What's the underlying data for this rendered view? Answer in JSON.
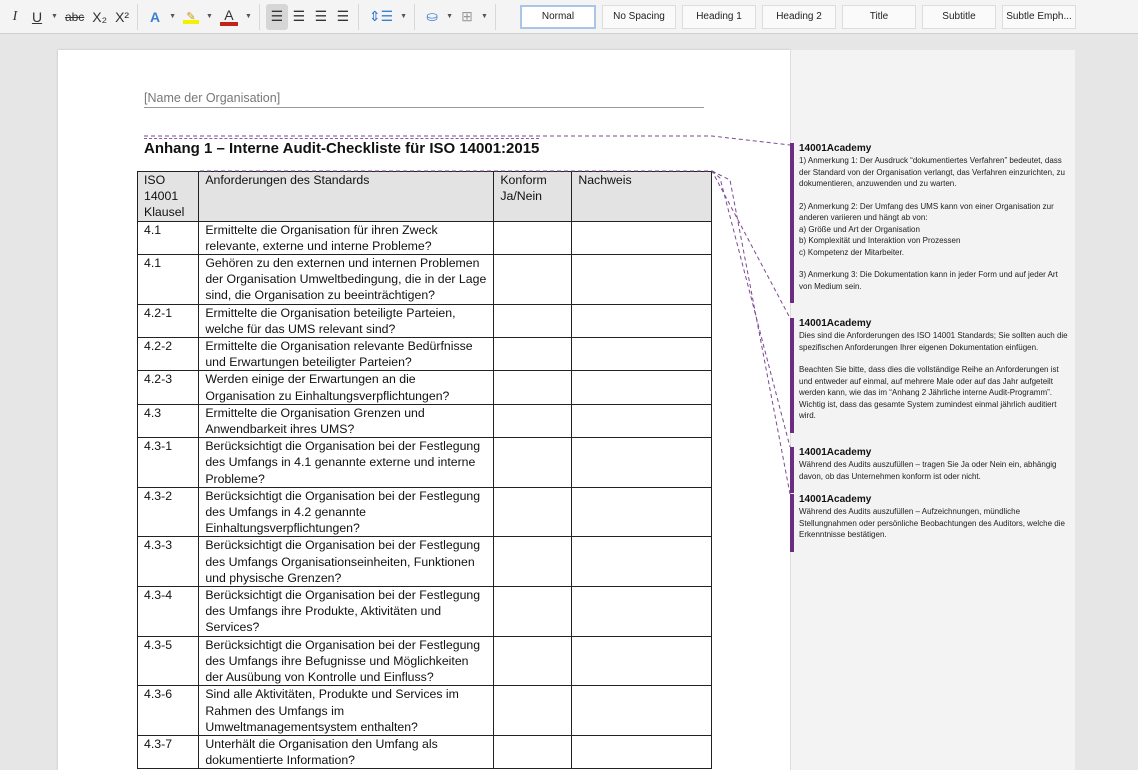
{
  "toolbar": {
    "buttons": [
      "I",
      "U",
      "abc",
      "X₂",
      "X²",
      "A",
      "A"
    ],
    "styles": [
      "Normal",
      "No Spacing",
      "Heading 1",
      "Heading 2",
      "Title",
      "Subtitle",
      "Subtle Emph..."
    ],
    "highlight_color": "#f2f200",
    "font_color": "#c0241b"
  },
  "document": {
    "org": "[Name der Organisation]",
    "title": "Anhang 1 – Interne Audit-Checkliste für ISO 14001:2015",
    "headers": [
      "ISO 14001 Klausel",
      "Anforderungen des Standards",
      "Konform Ja/Nein",
      "Nachweis"
    ],
    "rows": [
      [
        "4.1",
        "Ermittelte die Organisation für ihren Zweck relevante, externe und interne Probleme?"
      ],
      [
        "4.1",
        "Gehören zu den externen und internen Problemen der Organisation Umweltbedingung, die in der Lage sind, die Organisation zu beeinträchtigen?"
      ],
      [
        "4.2-1",
        "Ermittelte die Organisation beteiligte Parteien, welche für das UMS relevant sind?"
      ],
      [
        "4.2-2",
        "Ermittelte die Organisation relevante Bedürfnisse und Erwartungen beteiligter Parteien?"
      ],
      [
        "4.2-3",
        "Werden einige der Erwartungen an die Organisation zu Einhaltungsverpflichtungen?"
      ],
      [
        "4.3",
        "Ermittelte die Organisation Grenzen und Anwendbarkeit ihres UMS?"
      ],
      [
        "4.3-1",
        "Berücksichtigt die Organisation bei der Festlegung des Umfangs in 4.1 genannte externe und interne Probleme?"
      ],
      [
        "4.3-2",
        "Berücksichtigt die Organisation bei der Festlegung des Umfangs in 4.2 genannte Einhaltungsverpflichtungen?"
      ],
      [
        "4.3-3",
        "Berücksichtigt die Organisation bei der Festlegung des Umfangs Organisationseinheiten, Funktionen und physische Grenzen?"
      ],
      [
        "4.3-4",
        "Berücksichtigt die Organisation bei der Festlegung des Umfangs ihre Produkte, Aktivitäten und Services?"
      ],
      [
        "4.3-5",
        "Berücksichtigt die Organisation bei der Festlegung des Umfangs ihre Befugnisse und Möglichkeiten der Ausübung von Kontrolle und Einfluss?"
      ],
      [
        "4.3-6",
        "Sind alle Aktivitäten, Produkte und Services im Rahmen des Umfangs im Umweltmanagementsystem enthalten?"
      ],
      [
        "4.3-7",
        "Unterhält die Organisation den Umfang als dokumentierte Information?"
      ]
    ]
  },
  "comments": [
    {
      "author": "14001Academy",
      "paras": [
        "1) Anmerkung 1: Der Ausdruck “dokumentiertes Verfahren” bedeutet, dass der Standard von der Organisation verlangt, das Verfahren einzurichten, zu dokumentieren, anzuwenden und zu warten.",
        "2) Anmerkung 2: Der Umfang des UMS kann von einer Organisation zur anderen variieren und hängt ab von:\na) Größe und Art der Organisation\nb) Komplexität und Interaktion von Prozessen\nc) Kompetenz der Mitarbeiter.",
        "3) Anmerkung 3: Die Dokumentation kann in jeder Form und auf jeder Art von Medium sein."
      ]
    },
    {
      "author": "14001Academy",
      "paras": [
        "Dies sind die Anforderungen des ISO 14001 Standards; Sie sollten auch die spezifischen Anforderungen Ihrer eigenen Dokumentation einfügen.",
        "Beachten Sie bitte, dass dies die vollständige Reihe an Anforderungen ist und entweder auf einmal, auf mehrere Male oder auf das Jahr aufgeteilt werden kann, wie das im “Anhang 2 Jährliche interne Audit-Programm”. Wichtig ist, dass das gesamte System zumindest einmal jährlich auditiert wird."
      ]
    },
    {
      "author": "14001Academy",
      "paras": [
        "Während des Audits auszufüllen – tragen Sie Ja oder Nein ein, abhängig davon, ob das Unternehmen konform ist oder nicht."
      ]
    },
    {
      "author": "14001Academy",
      "paras": [
        "Während des Audits auszufüllen – Aufzeichnungen, mündliche Stellungnahmen oder persönliche Beobachtungen des Auditors, welche die Erkenntnisse bestätigen."
      ]
    }
  ],
  "accent": "#6b2c82"
}
